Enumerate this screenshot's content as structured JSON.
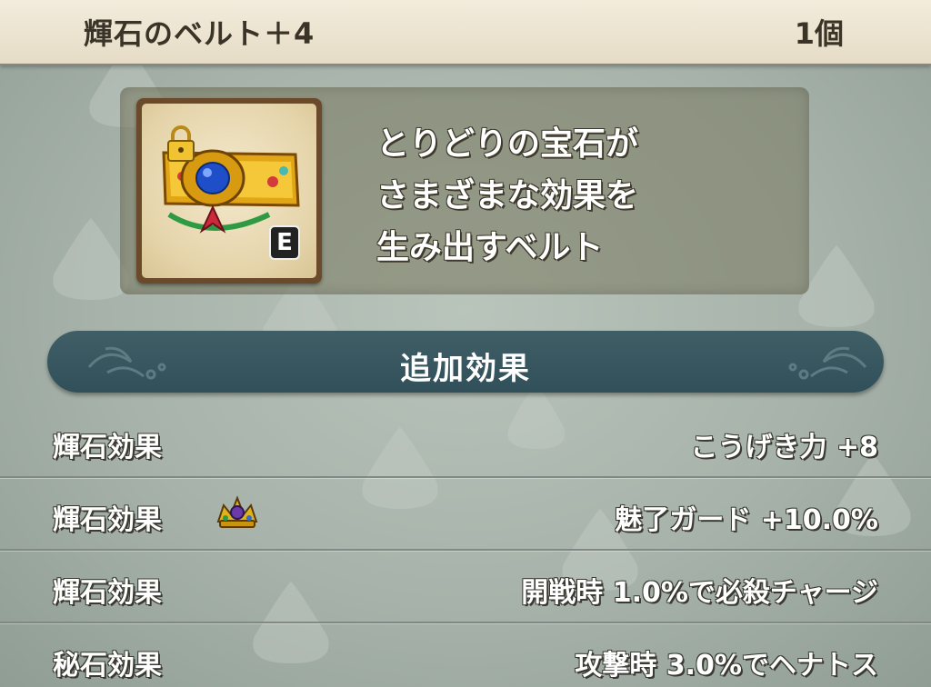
{
  "header": {
    "item_name": "輝石のベルト＋4",
    "count": "1個"
  },
  "item": {
    "icon": "jeweled-belt-icon",
    "locked_icon": "padlock-icon",
    "equipped_badge": "E",
    "description_lines": [
      "とりどりの宝石が",
      "さまざまな効果を",
      "生み出すベルト"
    ]
  },
  "section": {
    "title": "追加効果"
  },
  "effects": [
    {
      "name": "輝石効果",
      "value": "こうげき力 +8"
    },
    {
      "name": "輝石効果",
      "value": "魅了ガード +10.0%",
      "icon": "crown-icon"
    },
    {
      "name": "輝石効果",
      "value": "開戦時  1.0%で必殺チャージ"
    },
    {
      "name": "秘石効果",
      "value": "攻撃時  3.0%でヘナトス"
    }
  ],
  "colors": {
    "header_bg": "#efe7d5",
    "banner_bg": "#36555f",
    "panel_bg": "#8d8a6c",
    "text_light": "#ffffff",
    "text_dark": "#3a3328"
  }
}
